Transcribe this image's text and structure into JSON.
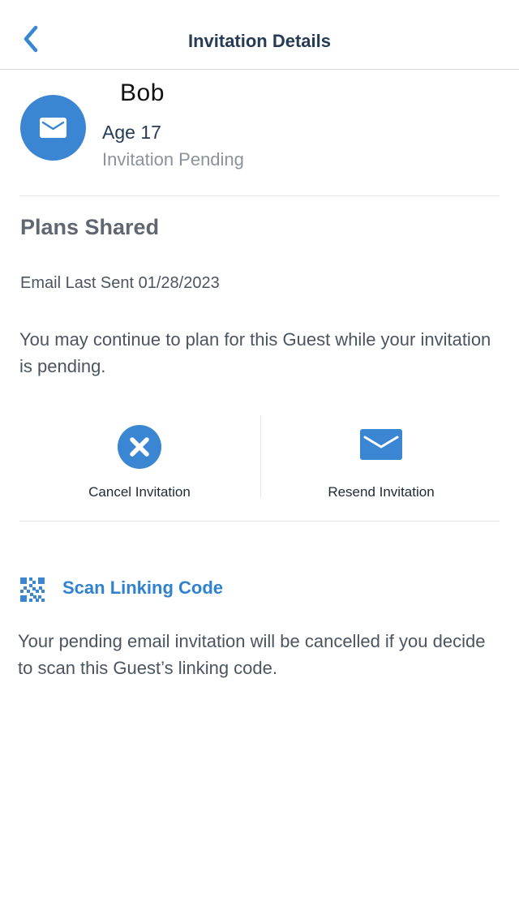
{
  "header": {
    "title": "Invitation Details",
    "back_icon": "chevron-left-icon"
  },
  "guest": {
    "name": "Bob",
    "age": "Age 17",
    "status": "Invitation Pending",
    "avatar_icon": "envelope-icon"
  },
  "plans": {
    "title": "Plans Shared",
    "email_sent": "Email Last Sent 01/28/2023",
    "note": "You may continue to plan for this Guest while your invitation is pending."
  },
  "actions": {
    "cancel": {
      "label": "Cancel Invitation",
      "icon": "close-circle-icon"
    },
    "resend": {
      "label": "Resend Invitation",
      "icon": "envelope-icon"
    }
  },
  "scan": {
    "label": "Scan Linking Code",
    "icon": "qr-code-icon",
    "note": "Your pending email invitation will be cancelled if you decide to scan this Guest’s linking code."
  },
  "colors": {
    "accent": "#3B86D2",
    "link": "#2F82CF",
    "title_text": "#253B56",
    "muted_text": "#8A939C"
  }
}
